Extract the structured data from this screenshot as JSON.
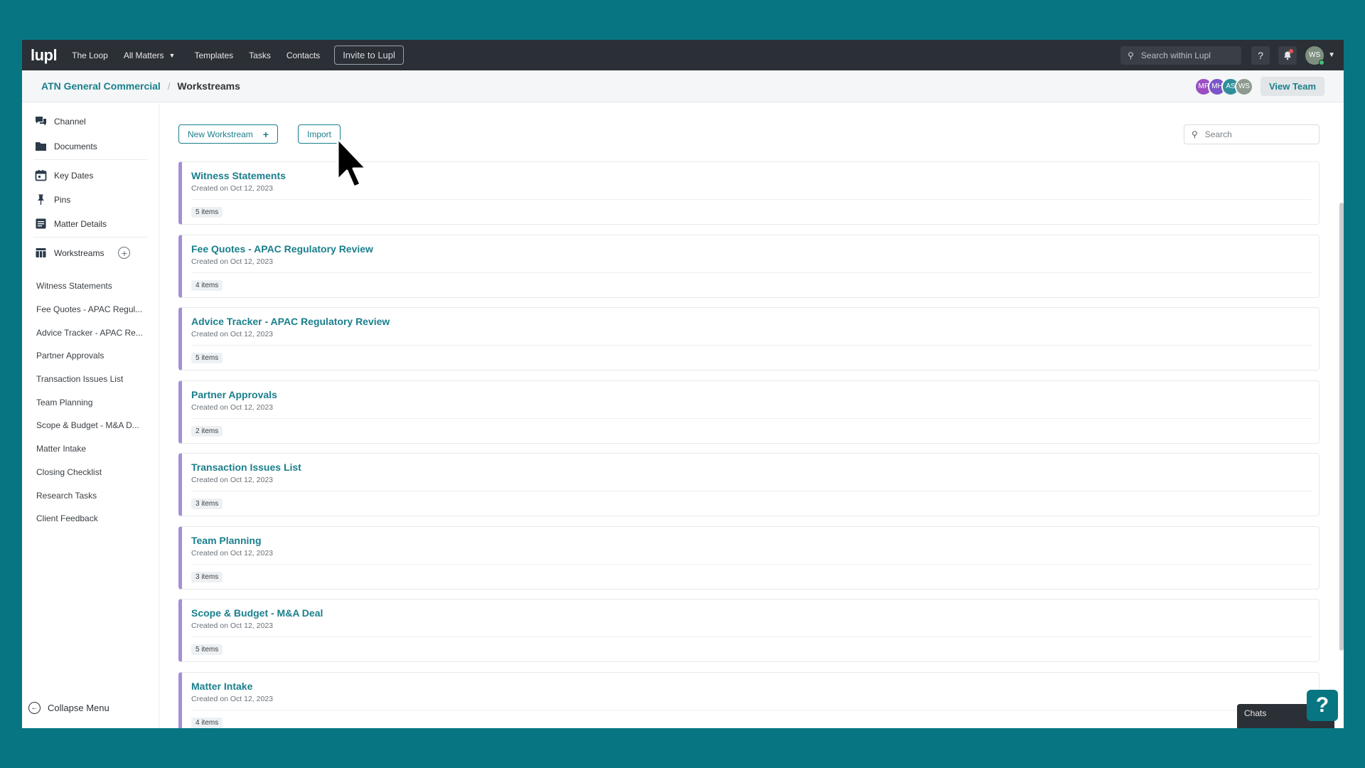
{
  "topnav": {
    "logo": "lupl",
    "items": [
      "The Loop",
      "All Matters",
      "Templates",
      "Tasks",
      "Contacts"
    ],
    "invite_label": "Invite to Lupl",
    "search_placeholder": "Search within Lupl",
    "help_label": "?",
    "user_initials": "WS"
  },
  "breadcrumb": {
    "parent": "ATN General Commercial",
    "separator": "/",
    "current": "Workstreams"
  },
  "team": {
    "members": [
      {
        "initials": "MP",
        "color": "#9b4fc2"
      },
      {
        "initials": "MH",
        "color": "#7b55c9"
      },
      {
        "initials": "AS",
        "color": "#2e8f9a"
      },
      {
        "initials": "WS",
        "color": "#8e9a8f"
      }
    ],
    "view_label": "View Team"
  },
  "sidebar": {
    "items": [
      "Channel",
      "Documents",
      "Key Dates",
      "Pins",
      "Matter Details"
    ],
    "workstreams_label": "Workstreams",
    "workstreams": [
      "Witness Statements",
      "Fee Quotes - APAC Regul...",
      "Advice Tracker - APAC Re...",
      "Partner Approvals",
      "Transaction Issues List",
      "Team Planning",
      "Scope & Budget - M&A D...",
      "Matter Intake",
      "Closing Checklist",
      "Research Tasks",
      "Client Feedback"
    ],
    "collapse_label": "Collapse Menu"
  },
  "main": {
    "new_workstream_label": "New Workstream",
    "import_label": "Import",
    "search_placeholder": "Search",
    "cards": [
      {
        "title": "Witness Statements",
        "created": "Created on Oct 12, 2023",
        "items": "5 items"
      },
      {
        "title": "Fee Quotes - APAC Regulatory Review",
        "created": "Created on Oct 12, 2023",
        "items": "4 items"
      },
      {
        "title": "Advice Tracker - APAC Regulatory Review",
        "created": "Created on Oct 12, 2023",
        "items": "5 items"
      },
      {
        "title": "Partner Approvals",
        "created": "Created on Oct 12, 2023",
        "items": "2 items"
      },
      {
        "title": "Transaction Issues List",
        "created": "Created on Oct 12, 2023",
        "items": "3 items"
      },
      {
        "title": "Team Planning",
        "created": "Created on Oct 12, 2023",
        "items": "3 items"
      },
      {
        "title": "Scope & Budget - M&A Deal",
        "created": "Created on Oct 12, 2023",
        "items": "5 items"
      },
      {
        "title": "Matter Intake",
        "created": "Created on Oct 12, 2023",
        "items": "4 items"
      }
    ]
  },
  "chats_label": "Chats",
  "help_fab_label": "?",
  "colors": {
    "background": "#077682",
    "accent": "#1a7f8c",
    "card_border": "#a68ed6",
    "nav": "#2b2f36"
  }
}
